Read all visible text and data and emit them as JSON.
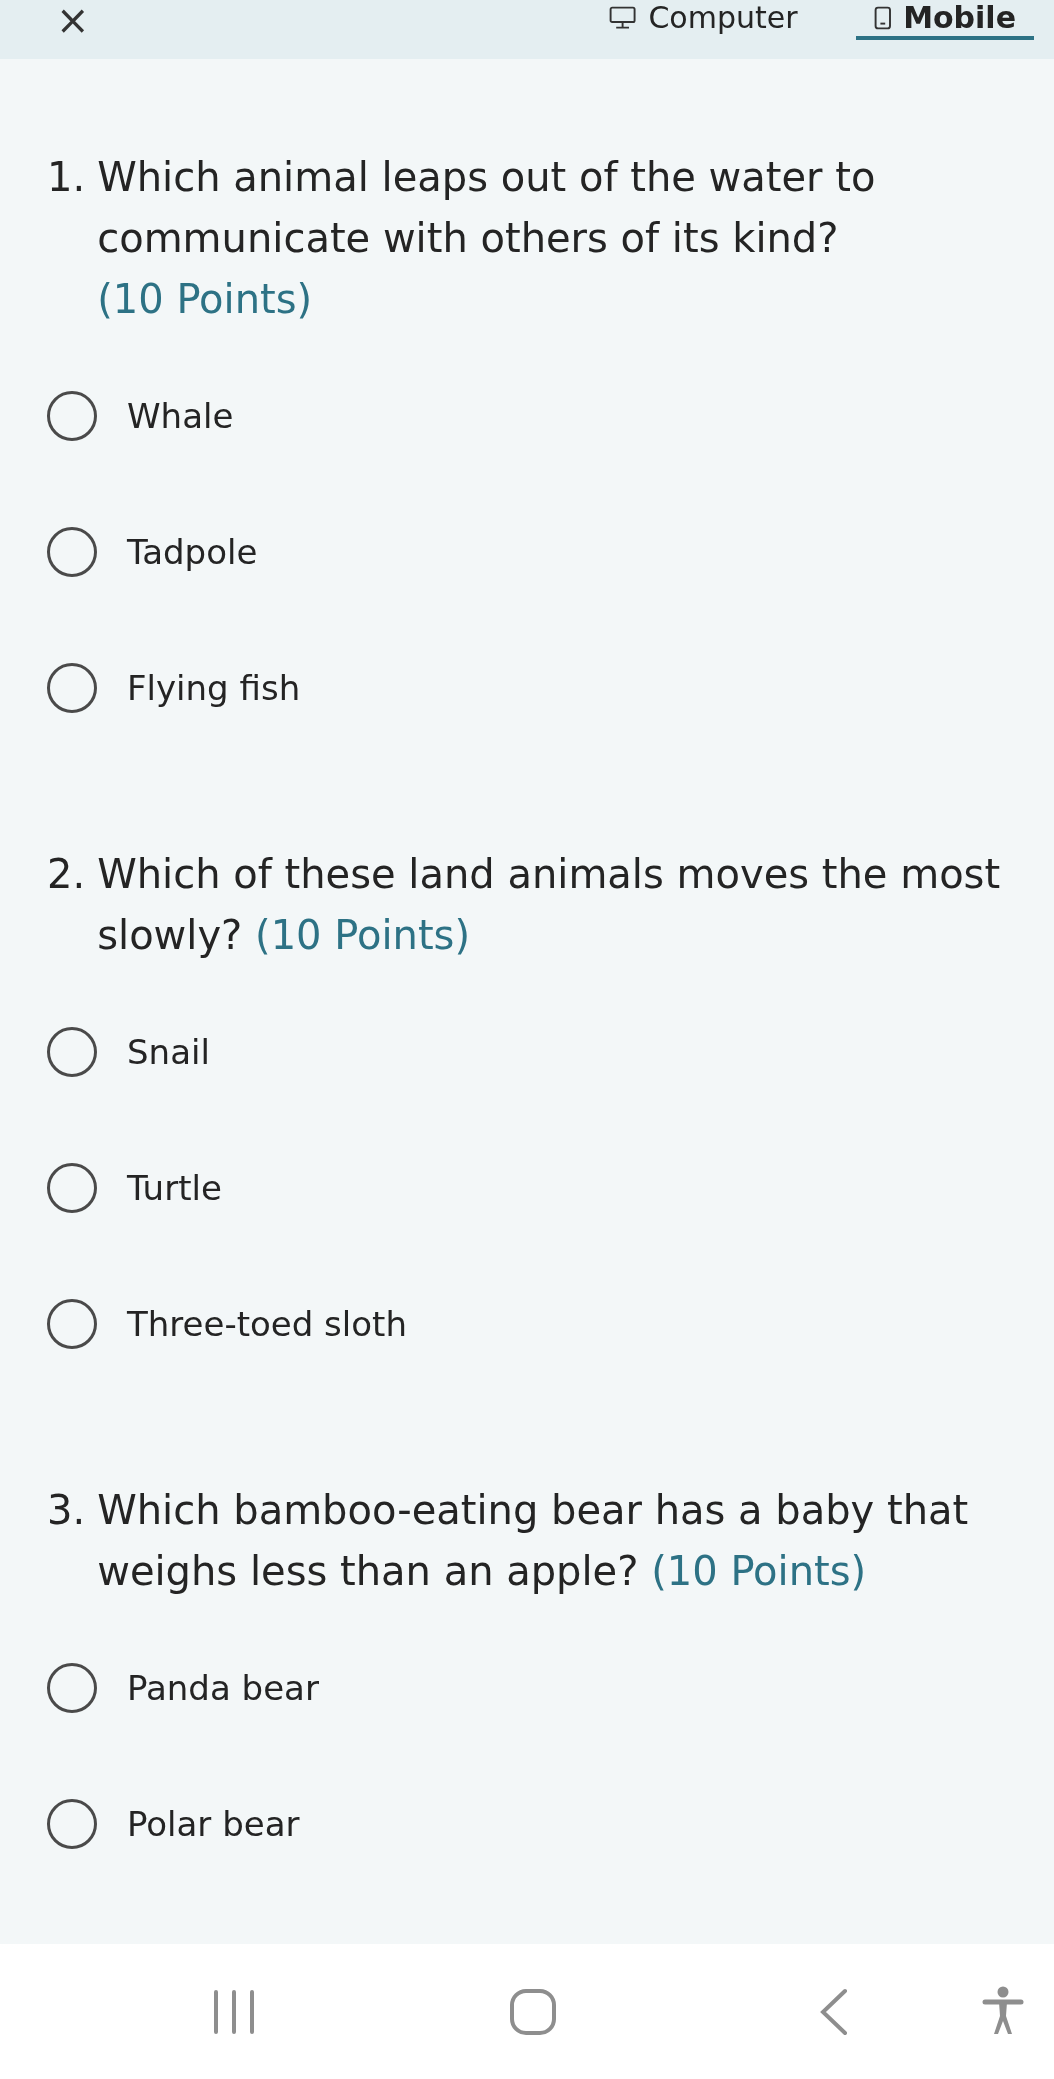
{
  "header": {
    "close": "×",
    "tabs": [
      {
        "label": "Computer",
        "selected": false,
        "kind": "computer"
      },
      {
        "label": "Mobile",
        "selected": true,
        "kind": "mobile"
      }
    ]
  },
  "questions": [
    {
      "number": "1.",
      "text": "Which animal leaps out of the water to communicate with others of its kind?",
      "points": "(10 Points)",
      "options": [
        {
          "label": "Whale",
          "selected": false
        },
        {
          "label": "Tadpole",
          "selected": false
        },
        {
          "label": "Flying fish",
          "selected": false
        }
      ]
    },
    {
      "number": "2.",
      "text": "Which of these land animals moves the most slowly?",
      "points": "(10 Points)",
      "options": [
        {
          "label": "Snail",
          "selected": false
        },
        {
          "label": "Turtle",
          "selected": false
        },
        {
          "label": "Three-toed sloth",
          "selected": false
        }
      ]
    },
    {
      "number": "3.",
      "text": "Which bamboo-eating bear has a baby that weighs less than an apple?",
      "points": "(10 Points)",
      "options": [
        {
          "label": "Panda bear",
          "selected": false
        },
        {
          "label": "Polar bear",
          "selected": false
        }
      ]
    }
  ]
}
